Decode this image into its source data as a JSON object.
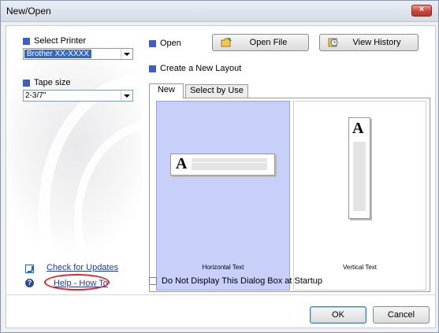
{
  "window": {
    "title": "New/Open",
    "close_label": "×"
  },
  "left": {
    "select_printer_label": "Select Printer",
    "printer_value": "Brother XX-XXXX",
    "tape_size_label": "Tape size",
    "tape_size_value": "2-3/7\"",
    "check_updates_label": "Check for Updates",
    "help_label": "Help - How To"
  },
  "open_section": {
    "open_label": "Open",
    "open_file_button": "Open File",
    "view_history_button": "View History"
  },
  "create_label": "Create a New Layout",
  "tabs": [
    {
      "label": "New"
    },
    {
      "label": "Select by Use"
    }
  ],
  "layouts": [
    {
      "label": "Horizontal Text",
      "glyph": "A"
    },
    {
      "label": "Vertical Text",
      "glyph": "A"
    }
  ],
  "startup_checkbox_label": "Do Not Display This Dialog Box at Startup",
  "footer": {
    "ok_label": "OK",
    "cancel_label": "Cancel"
  },
  "colors": {
    "accent_square": "#3a5fc7",
    "selected_card": "#c8cff8",
    "link": "#1a3cb0",
    "highlight_ring": "#e0242a"
  }
}
